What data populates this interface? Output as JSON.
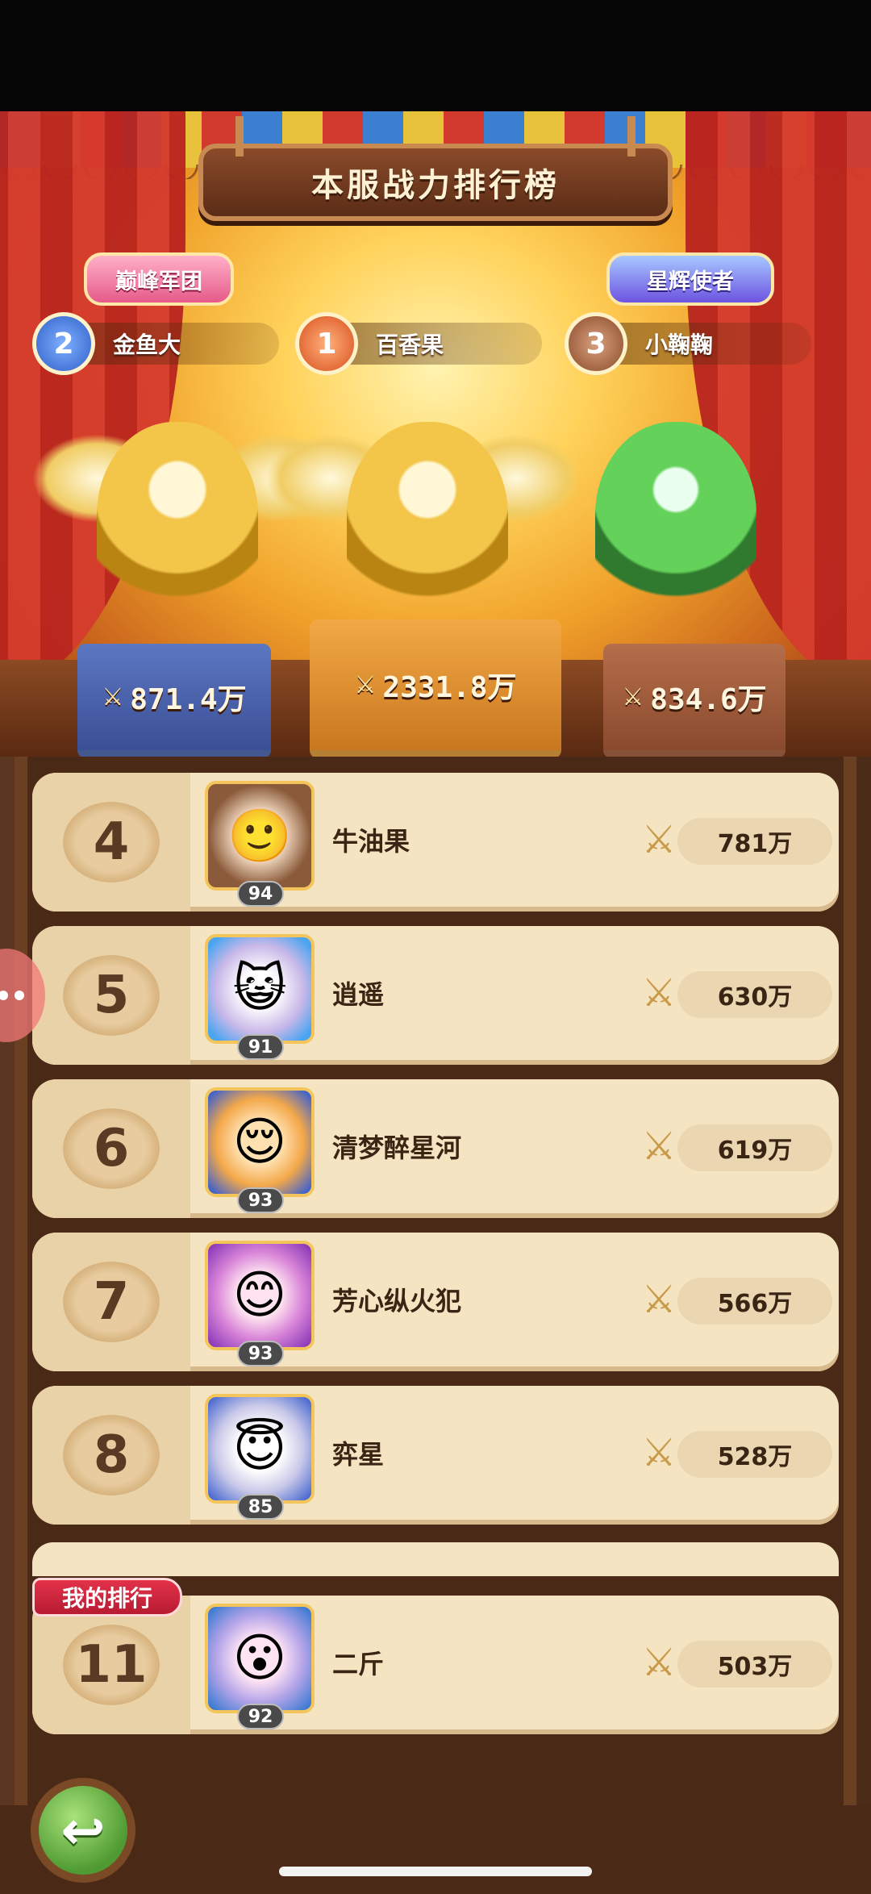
{
  "header": {
    "title": "本服战力排行榜",
    "badge_left": "巅峰军团",
    "badge_right": "星辉使者"
  },
  "top3": [
    {
      "rank": "2",
      "name": "金鱼大",
      "power": "871.4万"
    },
    {
      "rank": "1",
      "name": "百香果",
      "power": "2331.8万"
    },
    {
      "rank": "3",
      "name": "小鞠鞠",
      "power": "834.6万"
    }
  ],
  "rankings": [
    {
      "rank": "4",
      "name": "牛油果",
      "level": "94",
      "power": "781万"
    },
    {
      "rank": "5",
      "name": "逍遥",
      "level": "91",
      "power": "630万"
    },
    {
      "rank": "6",
      "name": "清梦醉星河",
      "level": "93",
      "power": "619万"
    },
    {
      "rank": "7",
      "name": "芳心纵火犯",
      "level": "93",
      "power": "566万"
    },
    {
      "rank": "8",
      "name": "弈星",
      "level": "85",
      "power": "528万"
    }
  ],
  "my_rank": {
    "label": "我的排行",
    "rank": "11",
    "name": "二斤",
    "level": "92",
    "power": "503万"
  },
  "icons": {
    "sword": "crossed-swords-icon",
    "back": "back-arrow-icon"
  }
}
